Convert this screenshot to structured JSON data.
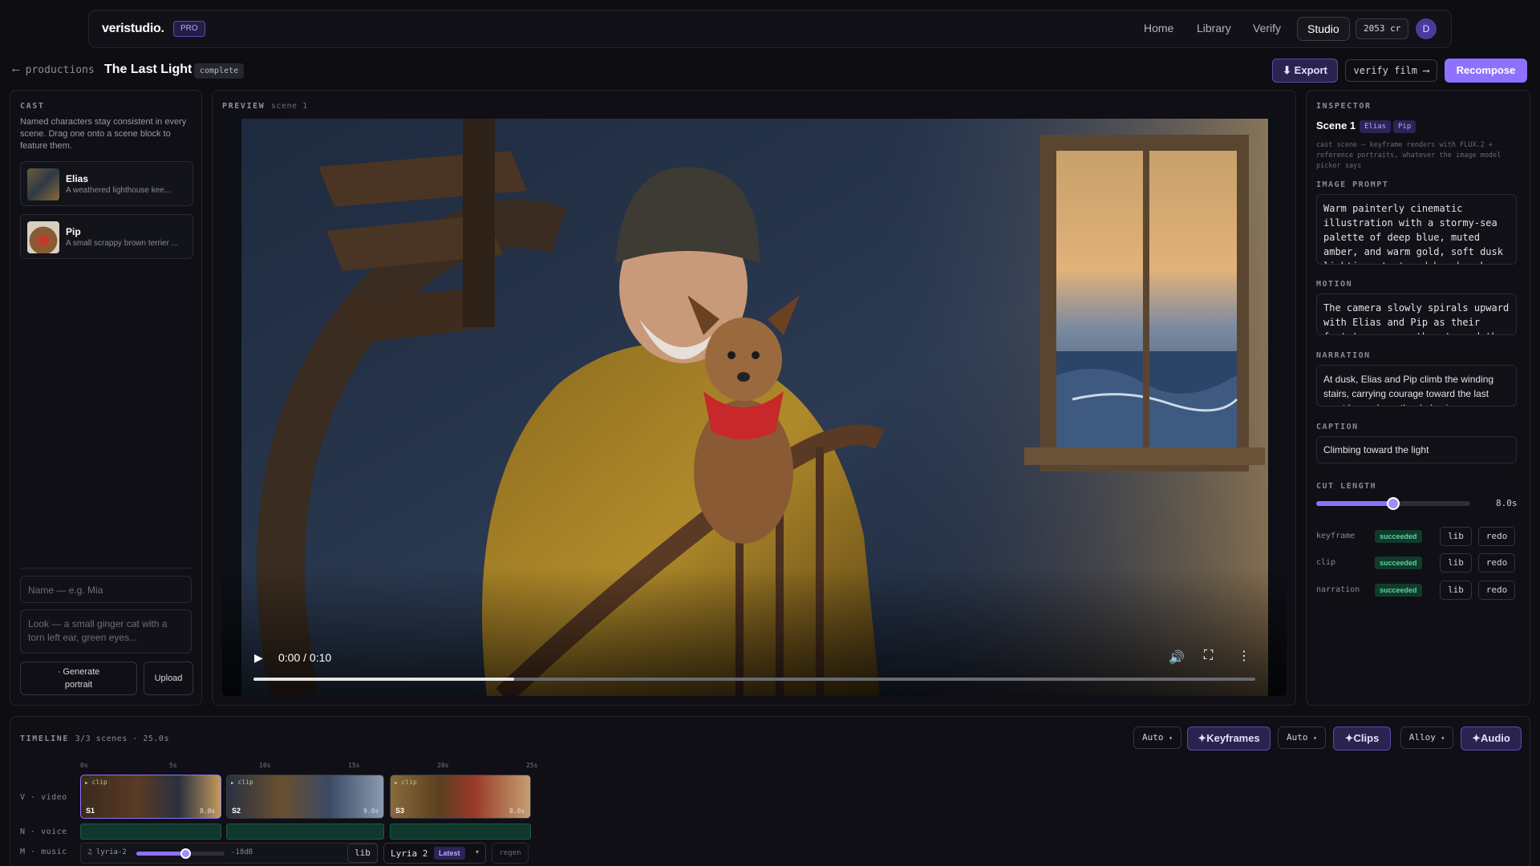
{
  "nav": {
    "brand": "veristudio.",
    "badge": "PRO",
    "links": [
      "Home",
      "Library",
      "Verify"
    ],
    "active": "Studio",
    "credits": "2053 cr",
    "avatar": "D"
  },
  "header": {
    "back_icon": "arrow-left-icon",
    "back": "productions",
    "title": "The Last Light",
    "status": "complete",
    "export": "Export",
    "verify": "verify film",
    "recompose": "Recompose"
  },
  "cast": {
    "tag": "CAST",
    "description": "Named characters stay consistent in every scene. Drag one onto a scene block to feature them.",
    "members": [
      {
        "name": "Elias",
        "desc": "A weathered lighthouse kee..."
      },
      {
        "name": "Pip",
        "desc": "A small scrappy brown terrier ..."
      }
    ],
    "name_placeholder": "Name — e.g. Mia",
    "look_placeholder": "Look — a small ginger cat with a torn left ear, green eyes...",
    "generate_line1": "· Generate",
    "generate_line2": "portrait",
    "upload": "Upload"
  },
  "preview": {
    "tag": "PREVIEW",
    "scene": "scene 1",
    "time": "0:00 / 0:10",
    "progress": 0.26
  },
  "inspector": {
    "tag": "INSPECTOR",
    "scene": "Scene 1",
    "chars": [
      "Elias",
      "Pip"
    ],
    "note": "cast scene — keyframe renders with FLUX.2 + reference portraits, whatever the image model picker says",
    "image_prompt_label": "IMAGE PROMPT",
    "image_prompt": "Warm painterly cinematic illustration with a stormy-sea palette of deep blue, muted amber, and warm gold, soft dusk lighting, textured brushwork",
    "motion_label": "MOTION",
    "motion": "The camera slowly spirals upward with Elias and Pip as their footsteps carry them toward the",
    "narration_label": "NARRATION",
    "narration": "At dusk, Elias and Pip climb the winding stairs, carrying courage toward the last great lamp above the darkening sea.",
    "caption_label": "CAPTION",
    "caption": "Climbing toward the light",
    "cut_label": "CUT LENGTH",
    "cut_value": "8.0s",
    "cut_fraction": 0.5,
    "status_rows": [
      {
        "name": "keyframe",
        "status": "succeeded",
        "lib": "lib",
        "redo": "redo"
      },
      {
        "name": "clip",
        "status": "succeeded",
        "lib": "lib",
        "redo": "redo"
      },
      {
        "name": "narration",
        "status": "succeeded",
        "lib": "lib",
        "redo": "redo"
      }
    ]
  },
  "timeline": {
    "tag": "TIMELINE",
    "summary": "3/3 scenes · 25.0s",
    "auto1": "Auto",
    "keyframes": "Keyframes",
    "auto2": "Auto",
    "clips": "Clips",
    "voice": "Alloy",
    "audio": "Audio",
    "ticks": [
      "0s",
      "5s",
      "10s",
      "15s",
      "20s",
      "25s"
    ],
    "tracks": [
      "V · video",
      "N · voice",
      "M · music"
    ],
    "clip_tag": "clip",
    "scenes": [
      {
        "label": "S1",
        "dur": "8.0s"
      },
      {
        "label": "S2",
        "dur": "9.0s"
      },
      {
        "label": "S3",
        "dur": "8.0s"
      }
    ],
    "music_model": "lyria-2",
    "music_db": "-18dB",
    "music_fraction": 0.55,
    "music_lib": "lib",
    "music_select": "Lyria 2",
    "music_latest": "Latest",
    "music_regen": "regen"
  }
}
